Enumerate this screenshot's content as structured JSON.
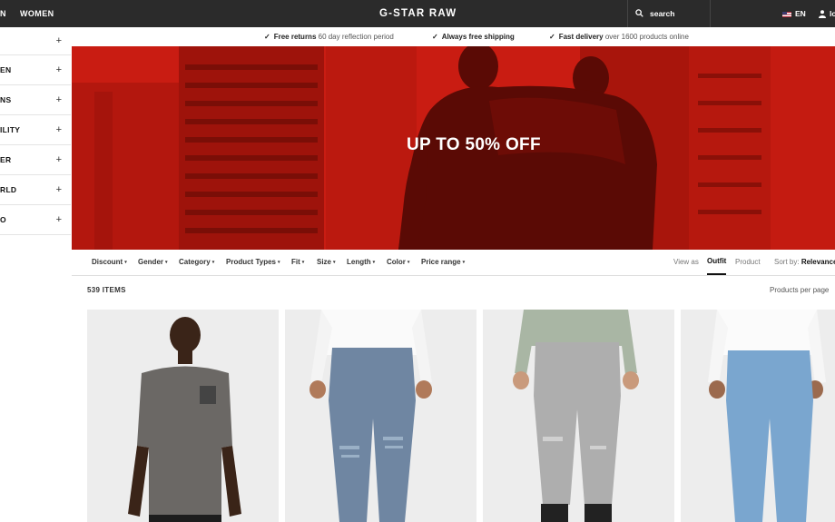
{
  "nav": {
    "men_label": "N",
    "women_label": "WOMEN",
    "logo": "G-STAR RAW",
    "search_label": "search",
    "lang_label": "EN",
    "user_label": "lo"
  },
  "sidebar": {
    "items": [
      {
        "label": ""
      },
      {
        "label": "EN"
      },
      {
        "label": "NS"
      },
      {
        "label": "ILITY"
      },
      {
        "label": "ER"
      },
      {
        "label": "RLD"
      },
      {
        "label": "O"
      }
    ]
  },
  "usp": [
    {
      "bold": "Free returns",
      "rest": " 60 day reflection period"
    },
    {
      "bold": "Always free shipping",
      "rest": ""
    },
    {
      "bold": "Fast delivery",
      "rest": " over 1600 products online"
    }
  ],
  "hero": {
    "title": "UP TO 50% OFF"
  },
  "filters": [
    "Discount",
    "Gender",
    "Category",
    "Product Types",
    "Fit",
    "Size",
    "Length",
    "Color",
    "Price range"
  ],
  "view": {
    "label": "View as",
    "outfit": "Outfit",
    "product": "Product"
  },
  "sort": {
    "label": "Sort by:",
    "value": "Relevance"
  },
  "items_count": "539 ITEMS",
  "per_page_label": "Products per page",
  "products": [
    {
      "kind": "tshirt"
    },
    {
      "kind": "jeans-blue-ripped"
    },
    {
      "kind": "jeans-grey"
    },
    {
      "kind": "jeans-light-blue"
    }
  ],
  "colors": {
    "hero_red": "#c81a10",
    "nav_bg": "#2b2b2b"
  }
}
